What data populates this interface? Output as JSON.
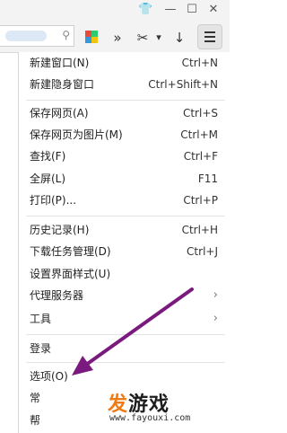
{
  "window_controls": {
    "skin": "👕",
    "minimize": "—",
    "maximize": "☐",
    "close": "✕"
  },
  "toolbar": {
    "double_chevron": "»",
    "cut_icon": "✂",
    "dropdown": "▾",
    "download_icon": "↓"
  },
  "menu": {
    "items": [
      {
        "label": "新建窗口(N)",
        "shortcut": "Ctrl+N"
      },
      {
        "label": "新建隐身窗口",
        "shortcut": "Ctrl+Shift+N"
      },
      {
        "label": "保存网页(A)",
        "shortcut": "Ctrl+S"
      },
      {
        "label": "保存网页为图片(M)",
        "shortcut": "Ctrl+M"
      },
      {
        "label": "查找(F)",
        "shortcut": "Ctrl+F"
      },
      {
        "label": "全屏(L)",
        "shortcut": "F11"
      },
      {
        "label": "打印(P)...",
        "shortcut": "Ctrl+P"
      },
      {
        "label": "历史记录(H)",
        "shortcut": "Ctrl+H"
      },
      {
        "label": "下载任务管理(D)",
        "shortcut": "Ctrl+J"
      },
      {
        "label": "设置界面样式(U)",
        "shortcut": ""
      },
      {
        "label": "代理服务器",
        "shortcut": "",
        "submenu": "›"
      },
      {
        "label": "工具",
        "shortcut": "",
        "submenu": "›"
      },
      {
        "label": "登录",
        "shortcut": ""
      },
      {
        "label": "选项(O)",
        "shortcut": ""
      },
      {
        "label": "常",
        "shortcut": ""
      },
      {
        "label": "帮",
        "shortcut": ""
      }
    ]
  },
  "watermark": {
    "logo_a": "发",
    "logo_b": "游戏",
    "url": "www.fayouxi.com"
  },
  "colors": {
    "arrow": "#7a1a7e",
    "watermark_orange": "#f07a14"
  }
}
